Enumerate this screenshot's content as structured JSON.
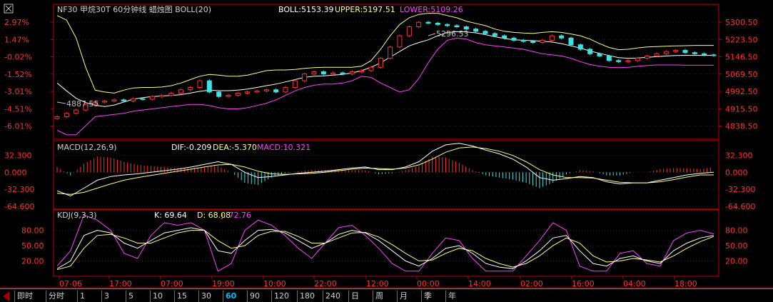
{
  "colors": {
    "background": "#000000",
    "frame": "#c00000",
    "grid": "#800000",
    "axis_text": "#ff3030",
    "boll_mid": "#ffffff",
    "boll_upper": "#ffff80",
    "boll_lower": "#ff40ff",
    "dif": "#ffffff",
    "dea": "#ffff80",
    "macd_text": "#ff40ff",
    "k": "#ffffff",
    "d": "#ffff80",
    "j": "#ff40ff",
    "candle_up": "#ff3030",
    "candle_down": "#40e0e0",
    "tab_active": "#00c0ff"
  },
  "main_panel": {
    "title": "NF30 甲烷30T 60分钟线 蜡烛图 BOLL(20)",
    "boll_label": "BOLL:5153.39",
    "upper_label": "UPPER:5197.51",
    "lower_label": "LOWER:5109.26",
    "max_annotation": "5296.53",
    "min_annotation": "4887.55"
  },
  "macd_panel": {
    "title": "MACD(12,26,9)",
    "dif_label": "DIF:-0.209",
    "dea_label": "DEA:-5.370",
    "macd_label": "MACD:10.321"
  },
  "kdj_panel": {
    "title": "KDJ(9,3,3)",
    "k_label": "K: 69.64",
    "d_label": "D: 68.08",
    "j_label": "J: 72.76"
  },
  "tabs": [
    "即时",
    "分时",
    "1",
    "3",
    "5",
    "10",
    "15",
    "30",
    "60",
    "90",
    "120",
    "180",
    "240",
    "日",
    "周",
    "月",
    "季",
    "年"
  ],
  "active_tab": "60",
  "chart_data": [
    {
      "type": "candlestick",
      "title": "NF30 甲烷30T 60分钟线 蜡烛图 BOLL(20)",
      "y_ticks_right": [
        "5300.50",
        "5223.50",
        "5146.50",
        "5069.50",
        "4992.50",
        "4915.50",
        "4838.50"
      ],
      "y_tick_values_right": [
        5300.5,
        5223.5,
        5146.5,
        5069.5,
        4992.5,
        4915.5,
        4838.5
      ],
      "y_ticks_left": [
        "2.97%",
        "1.47%",
        "-0.02%",
        "-1.52%",
        "-3.01%",
        "-4.51%",
        "-6.01%"
      ],
      "x_ticks": [
        "07-06",
        "17:00",
        "07:00",
        "19:00",
        "10:00",
        "22:00",
        "12:00",
        "00:00",
        "14:00",
        "02:00",
        "16:00",
        "04:00",
        "18:00"
      ],
      "ylim": [
        4780,
        5380
      ],
      "close": [
        4880,
        4895,
        4910,
        4935,
        4945,
        4950,
        4955,
        4950,
        4960,
        4958,
        4970,
        4975,
        4985,
        5000,
        5010,
        5040,
        4990,
        4970,
        4975,
        4985,
        4990,
        4995,
        5000,
        4990,
        5010,
        5040,
        5070,
        5080,
        5070,
        5075,
        5070,
        5080,
        5085,
        5100,
        5140,
        5190,
        5240,
        5280,
        5300,
        5296,
        5290,
        5285,
        5280,
        5270,
        5260,
        5250,
        5240,
        5230,
        5220,
        5215,
        5210,
        5220,
        5240,
        5230,
        5200,
        5180,
        5160,
        5150,
        5130,
        5125,
        5130,
        5140,
        5150,
        5160,
        5170,
        5175,
        5165,
        5160,
        5155,
        5153
      ],
      "boll": [
        5030,
        4995,
        4962,
        4943,
        4931,
        4925,
        4932,
        4945,
        4958,
        4965,
        4970,
        4972,
        4975,
        4978,
        4985,
        4993,
        4998,
        4996,
        4996,
        4998,
        5003,
        5010,
        5018,
        5025,
        5035,
        5045,
        5055,
        5060,
        5062,
        5065,
        5068,
        5075,
        5085,
        5100,
        5120,
        5145,
        5170,
        5195,
        5210,
        5222,
        5240,
        5255,
        5258,
        5257,
        5253,
        5245,
        5236,
        5228,
        5222,
        5220,
        5218,
        5216,
        5212,
        5205,
        5195,
        5185,
        5172,
        5162,
        5152,
        5143,
        5140,
        5141,
        5144,
        5147,
        5150,
        5152,
        5153,
        5153,
        5153,
        5153
      ],
      "upper": [
        5330,
        5310,
        5230,
        5100,
        4998,
        4990,
        4985,
        4998,
        5008,
        5010,
        5010,
        5012,
        5018,
        5030,
        5045,
        5060,
        5068,
        5065,
        5060,
        5060,
        5065,
        5075,
        5085,
        5088,
        5088,
        5090,
        5095,
        5098,
        5100,
        5100,
        5100,
        5100,
        5105,
        5130,
        5180,
        5240,
        5290,
        5320,
        5335,
        5340,
        5340,
        5330,
        5320,
        5305,
        5295,
        5285,
        5270,
        5260,
        5255,
        5252,
        5250,
        5255,
        5258,
        5255,
        5248,
        5240,
        5225,
        5205,
        5188,
        5178,
        5180,
        5186,
        5190,
        5192,
        5194,
        5195,
        5196,
        5197,
        5197,
        5197
      ],
      "lower": [
        4820,
        4800,
        4800,
        4840,
        4880,
        4885,
        4890,
        4895,
        4905,
        4910,
        4915,
        4920,
        4925,
        4930,
        4935,
        4935,
        4930,
        4920,
        4915,
        4915,
        4920,
        4930,
        4940,
        4955,
        4975,
        4995,
        5010,
        5020,
        5025,
        5025,
        5030,
        5040,
        5060,
        5055,
        5030,
        5010,
        4990,
        5000,
        5050,
        5120,
        5180,
        5220,
        5230,
        5225,
        5210,
        5200,
        5195,
        5190,
        5185,
        5180,
        5170,
        5160,
        5155,
        5150,
        5140,
        5125,
        5112,
        5105,
        5100,
        5098,
        5100,
        5104,
        5108,
        5110,
        5110,
        5110,
        5109,
        5109,
        5109,
        5109
      ]
    },
    {
      "type": "line",
      "title": "MACD(12,26,9)",
      "y_ticks": [
        "32.300",
        "0.000",
        "-32.300",
        "-64.600"
      ],
      "y_tick_values": [
        32.3,
        0,
        -32.3,
        -64.6
      ],
      "ylim": [
        -70,
        60
      ],
      "series": [
        {
          "name": "DIF",
          "values": [
            -35,
            -45,
            -30,
            -15,
            -8,
            -5,
            -3,
            0,
            3,
            6,
            10,
            15,
            20,
            15,
            0,
            -10,
            -8,
            -5,
            -2,
            0,
            2,
            5,
            8,
            10,
            5,
            5,
            10,
            20,
            40,
            52,
            55,
            50,
            42,
            35,
            25,
            10,
            -10,
            -15,
            -12,
            -8,
            -10,
            -18,
            -22,
            -20,
            -20,
            -15,
            -10,
            -5,
            -2,
            0
          ]
        },
        {
          "name": "DEA",
          "values": [
            -40,
            -42,
            -38,
            -30,
            -22,
            -15,
            -10,
            -6,
            -2,
            2,
            6,
            10,
            14,
            15,
            10,
            2,
            -3,
            -4,
            -3,
            -2,
            0,
            3,
            6,
            8,
            7,
            6,
            8,
            14,
            25,
            38,
            46,
            48,
            45,
            40,
            32,
            20,
            5,
            -5,
            -10,
            -10,
            -11,
            -15,
            -19,
            -20,
            -20,
            -18,
            -14,
            -9,
            -5,
            -5
          ]
        },
        {
          "name": "MACD",
          "values": [
            10,
            -6,
            16,
            30,
            28,
            20,
            14,
            12,
            10,
            8,
            8,
            10,
            12,
            0,
            -20,
            -24,
            -10,
            -2,
            2,
            4,
            4,
            4,
            4,
            4,
            -4,
            -2,
            4,
            12,
            30,
            28,
            18,
            4,
            -6,
            -10,
            -14,
            -20,
            -30,
            -20,
            -4,
            4,
            2,
            -6,
            -6,
            0,
            0,
            6,
            8,
            8,
            6,
            10
          ]
        }
      ]
    },
    {
      "type": "line",
      "title": "KDJ(9,3,3)",
      "y_ticks": [
        "80.00",
        "50.00",
        "20.00"
      ],
      "y_tick_values": [
        80,
        50,
        20
      ],
      "ylim": [
        -10,
        120
      ],
      "series": [
        {
          "name": "K",
          "values": [
            5,
            20,
            70,
            80,
            75,
            55,
            45,
            60,
            75,
            80,
            85,
            80,
            40,
            35,
            60,
            80,
            82,
            75,
            60,
            45,
            55,
            72,
            80,
            75,
            60,
            40,
            20,
            10,
            25,
            45,
            50,
            35,
            15,
            8,
            5,
            20,
            40,
            65,
            70,
            40,
            15,
            10,
            25,
            30,
            20,
            15,
            40,
            55,
            65,
            70
          ]
        },
        {
          "name": "D",
          "values": [
            3,
            10,
            45,
            70,
            72,
            65,
            55,
            55,
            65,
            75,
            80,
            80,
            60,
            45,
            50,
            70,
            78,
            78,
            68,
            55,
            55,
            65,
            75,
            76,
            67,
            52,
            35,
            20,
            22,
            35,
            45,
            40,
            25,
            15,
            8,
            15,
            30,
            50,
            65,
            55,
            30,
            18,
            20,
            25,
            22,
            18,
            30,
            45,
            58,
            68
          ]
        },
        {
          "name": "J",
          "values": [
            10,
            40,
            110,
            100,
            80,
            35,
            25,
            70,
            95,
            90,
            95,
            80,
            0,
            15,
            80,
            100,
            90,
            70,
            45,
            25,
            55,
            85,
            90,
            70,
            45,
            15,
            0,
            0,
            35,
            65,
            60,
            25,
            0,
            0,
            0,
            30,
            60,
            95,
            80,
            10,
            0,
            0,
            35,
            40,
            15,
            10,
            60,
            75,
            80,
            73
          ]
        }
      ]
    }
  ]
}
